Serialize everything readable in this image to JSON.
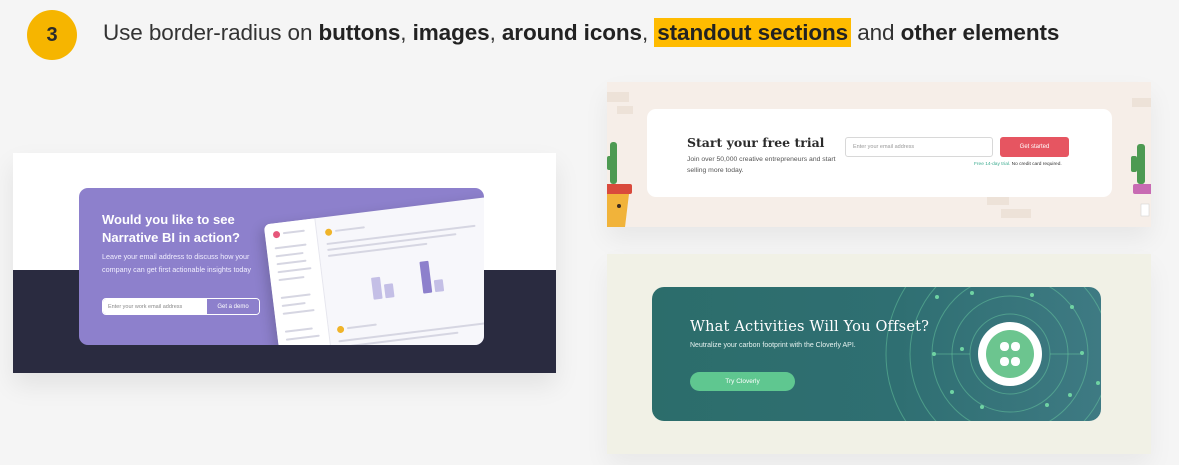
{
  "header": {
    "step_number": "3",
    "text_1": "Use border-radius on ",
    "bold_1": "buttons",
    "sep_1": ", ",
    "bold_2": "images",
    "sep_2": ", ",
    "bold_3": "around icons",
    "sep_3": ", ",
    "highlight": "standout sections",
    "text_2": " and ",
    "bold_4": "other elements"
  },
  "narrative": {
    "title": "Would you like to see Narrative BI in action?",
    "body": "Leave your email address to discuss how your company can get first actionable insights today",
    "input_placeholder": "Enter your work email address",
    "button": "Get a demo"
  },
  "trial": {
    "title": "Start your free trial",
    "body": "Join over 50,000 creative entrepreneurs and start selling more today.",
    "input_placeholder": "Enter your email address",
    "button": "Get started",
    "note_green": "Free 14-day trial.",
    "note_rest": " No credit card required."
  },
  "cloverly": {
    "title": "What Activities Will You Offset?",
    "body": "Neutralize your carbon footprint with the Cloverly API.",
    "button": "Try Cloverly"
  },
  "colors": {
    "badge": "#f6b500",
    "highlight": "#ffbb00",
    "narrative_purple": "#8d80cc",
    "narrative_dark": "#2a2b40",
    "trial_button": "#e65561",
    "cloverly_teal": "#2c6d6b",
    "cloverly_green": "#5fc790"
  },
  "icons": {
    "cloverly_logo": "clover-logo-icon"
  }
}
